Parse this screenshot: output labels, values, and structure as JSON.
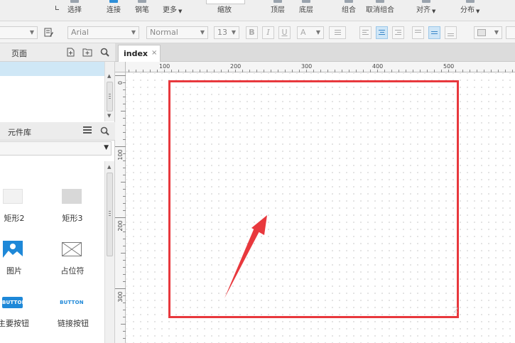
{
  "toolbar": {
    "items": [
      {
        "label": "选择",
        "icon": "select-icon"
      },
      {
        "label": "连接",
        "icon": "connect-icon"
      },
      {
        "label": "钢笔",
        "icon": "pen-icon"
      },
      {
        "label": "更多",
        "icon": "more-icon"
      },
      {
        "label": "缩放",
        "icon": "zoom-icon"
      },
      {
        "label": "顶层",
        "icon": "bring-to-front-icon"
      },
      {
        "label": "底层",
        "icon": "send-to-back-icon"
      },
      {
        "label": "组合",
        "icon": "group-icon"
      },
      {
        "label": "取消组合",
        "icon": "ungroup-icon"
      },
      {
        "label": "对齐",
        "icon": "align-icon"
      },
      {
        "label": "分布",
        "icon": "distribute-icon"
      }
    ]
  },
  "format": {
    "font_family": "Arial",
    "font_style": "Normal",
    "font_size": "13",
    "bold": "B",
    "italic": "I",
    "underline": "U",
    "font_color": "A"
  },
  "pages_panel": {
    "title": "页面"
  },
  "library_panel": {
    "title": "元件库",
    "widgets": [
      {
        "label": "矩形2",
        "icon": "rectangle-light-icon"
      },
      {
        "label": "矩形3",
        "icon": "rectangle-gray-icon"
      },
      {
        "label": "图片",
        "icon": "image-icon"
      },
      {
        "label": "占位符",
        "icon": "placeholder-icon"
      },
      {
        "label": "主要按钮",
        "button_text": "BUTTON"
      },
      {
        "label": "链接按钮",
        "button_text": "BUTTON"
      }
    ]
  },
  "tabs": [
    {
      "label": "index",
      "close": "×"
    }
  ],
  "rulers": {
    "top": [
      "100",
      "200",
      "300",
      "400",
      "500"
    ],
    "left": [
      "0",
      "100",
      "200",
      "300"
    ]
  },
  "colors": {
    "accent": "#2e8fd8",
    "selection_row": "#cfe7f6",
    "shape_border": "#e8383d",
    "annotation_arrow": "#e8383d",
    "primary_button": "#1e88d8",
    "link_button_text": "#1e88d8"
  }
}
